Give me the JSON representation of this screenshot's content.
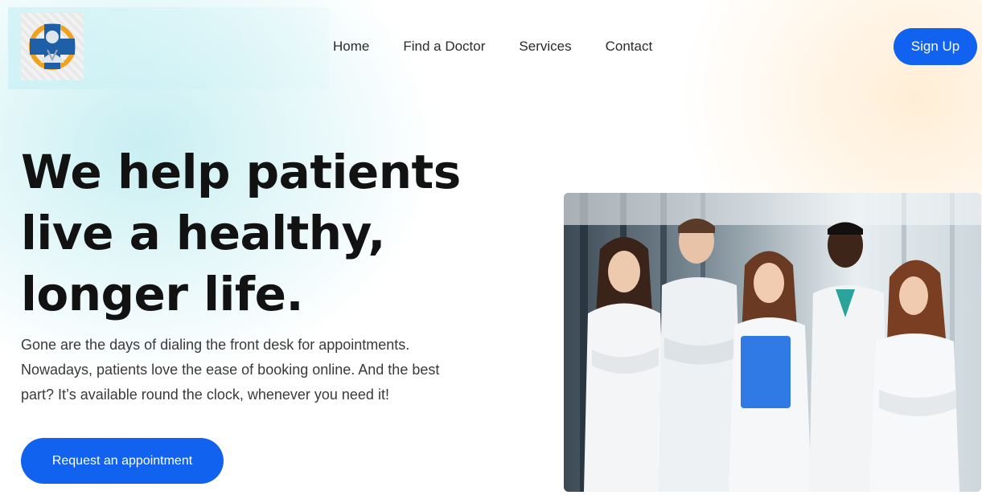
{
  "nav": {
    "items": [
      "Home",
      "Find a Doctor",
      "Services",
      "Contact"
    ],
    "signup_label": "Sign Up"
  },
  "hero": {
    "title_line1": "We help patients",
    "title_line2": "live a healthy,",
    "title_line3": "longer life.",
    "description_line1": "Gone are the days of dialing the front desk for appointments.",
    "description_line2": "Nowadays, patients love the ease of booking online. And the best",
    "description_line3": "part? It’s available round the clock, whenever you need it!",
    "cta_label": "Request an appointment"
  },
  "colors": {
    "accent": "#1162ef",
    "logo_blue": "#1f5fa8",
    "logo_orange": "#f0a21c"
  },
  "icons": {
    "logo": "medical-cross-doctor-logo"
  }
}
